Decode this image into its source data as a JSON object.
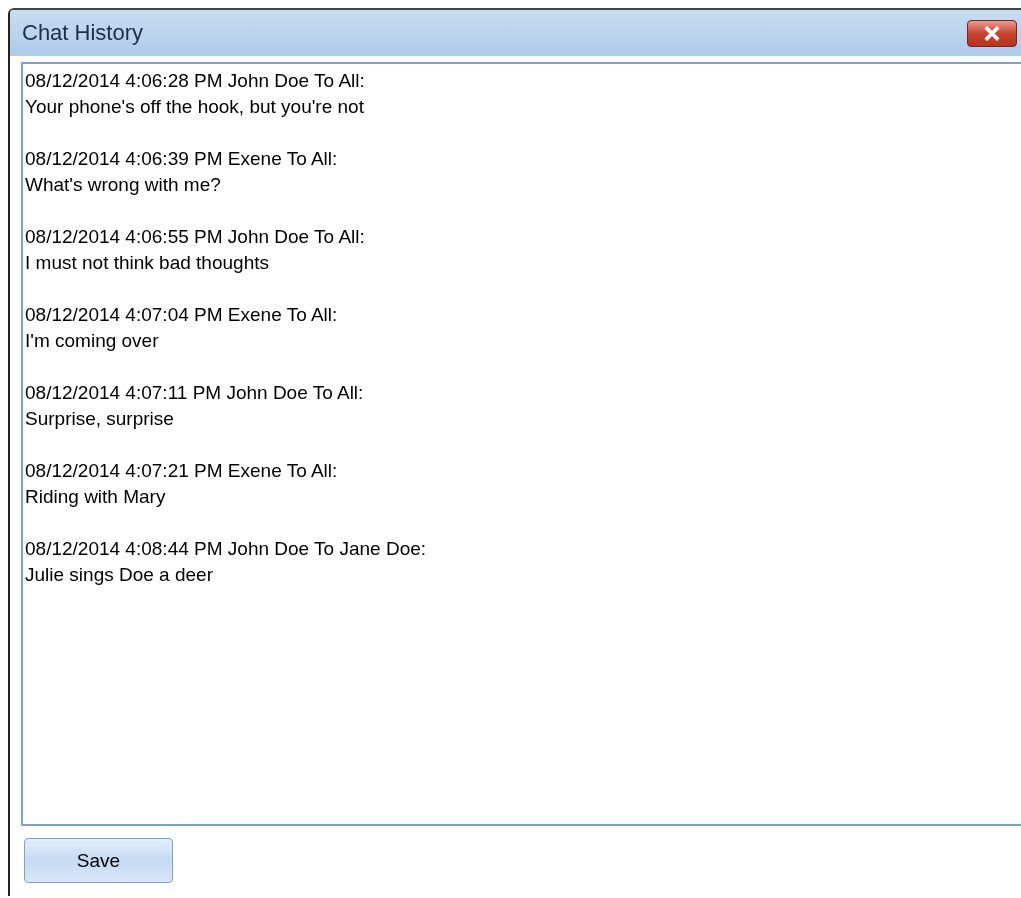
{
  "window": {
    "title": "Chat History"
  },
  "messages": [
    {
      "header": "08/12/2014 4:06:28 PM John Doe To All:",
      "text": "Your phone's off the hook, but you're not"
    },
    {
      "header": "08/12/2014 4:06:39 PM Exene To All:",
      "text": "What's wrong with me?"
    },
    {
      "header": "08/12/2014 4:06:55 PM John Doe To All:",
      "text": "I must not think bad thoughts"
    },
    {
      "header": "08/12/2014 4:07:04 PM Exene To All:",
      "text": "I'm coming over"
    },
    {
      "header": "08/12/2014 4:07:11 PM John Doe To All:",
      "text": "Surprise, surprise"
    },
    {
      "header": "08/12/2014 4:07:21 PM Exene To All:",
      "text": "Riding with Mary"
    },
    {
      "header": "08/12/2014 4:08:44 PM John Doe To Jane Doe:",
      "text": "Julie sings Doe a deer"
    }
  ],
  "buttons": [
    "Save"
  ]
}
